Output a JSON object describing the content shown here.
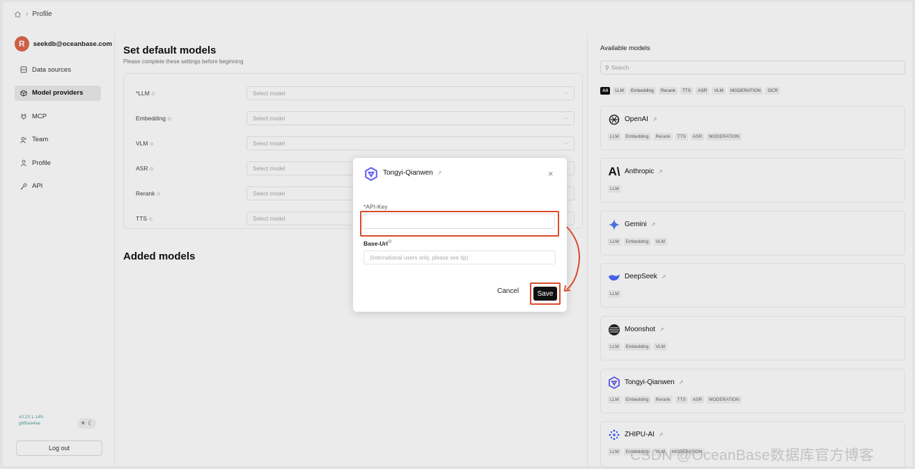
{
  "breadcrumb": {
    "current": "Profile"
  },
  "user": {
    "avatar_letter": "R",
    "email": "seekdb@oceanbase.com"
  },
  "sidebar": {
    "items": [
      {
        "label": "Data sources",
        "icon": "database-icon"
      },
      {
        "label": "Model providers",
        "icon": "cube-icon"
      },
      {
        "label": "MCP",
        "icon": "plug-icon"
      },
      {
        "label": "Team",
        "icon": "users-icon"
      },
      {
        "label": "Profile",
        "icon": "user-icon"
      },
      {
        "label": "API",
        "icon": "key-icon"
      }
    ],
    "active_item": "Model providers",
    "version": "v0.23.1-149-g6fbaa4aa",
    "logout_label": "Log out"
  },
  "main": {
    "title": "Set default models",
    "subtitle": "Please complete these settings before beginning",
    "rows": [
      {
        "label": "*LLM",
        "placeholder": "Select model"
      },
      {
        "label": "Embedding",
        "placeholder": "Select model"
      },
      {
        "label": "VLM",
        "placeholder": "Select model"
      },
      {
        "label": "ASR",
        "placeholder": "Select model"
      },
      {
        "label": "Rerank",
        "placeholder": "Select model"
      },
      {
        "label": "TTS",
        "placeholder": "Select model"
      }
    ],
    "added_title": "Added models"
  },
  "right": {
    "title": "Available models",
    "search_placeholder": "Search",
    "filters": [
      "All",
      "LLM",
      "Embedding",
      "Rerank",
      "TTS",
      "ASR",
      "VLM",
      "MODERATION",
      "OCR"
    ],
    "providers": [
      {
        "name": "OpenAI",
        "tags": [
          "LLM",
          "Embedding",
          "Rerank",
          "TTS",
          "ASR",
          "MODERATION"
        ]
      },
      {
        "name": "Anthropic",
        "tags": [
          "LLM"
        ]
      },
      {
        "name": "Gemini",
        "tags": [
          "LLM",
          "Embedding",
          "VLM"
        ]
      },
      {
        "name": "DeepSeek",
        "tags": [
          "LLM"
        ]
      },
      {
        "name": "Moonshot",
        "tags": [
          "LLM",
          "Embedding",
          "VLM"
        ]
      },
      {
        "name": "Tongyi-Qianwen",
        "tags": [
          "LLM",
          "Embedding",
          "Rerank",
          "TTS",
          "ASR",
          "MODERATION"
        ]
      },
      {
        "name": "ZHIPU-AI",
        "tags": [
          "LLM",
          "Embedding",
          "VLM",
          "MODERATION"
        ]
      }
    ]
  },
  "modal": {
    "title": "Tongyi-Qianwen",
    "api_key_label": "*API-Key",
    "api_key_value": "",
    "base_url_label": "Base-Url",
    "base_url_placeholder": "(International users only, please see tip)",
    "cancel_label": "Cancel",
    "save_label": "Save"
  },
  "colors": {
    "highlight": "#d94a2b",
    "avatar": "#e0664d",
    "primary_button": "#111111"
  },
  "watermark": "CSDN @OceanBase数据库官方博客"
}
